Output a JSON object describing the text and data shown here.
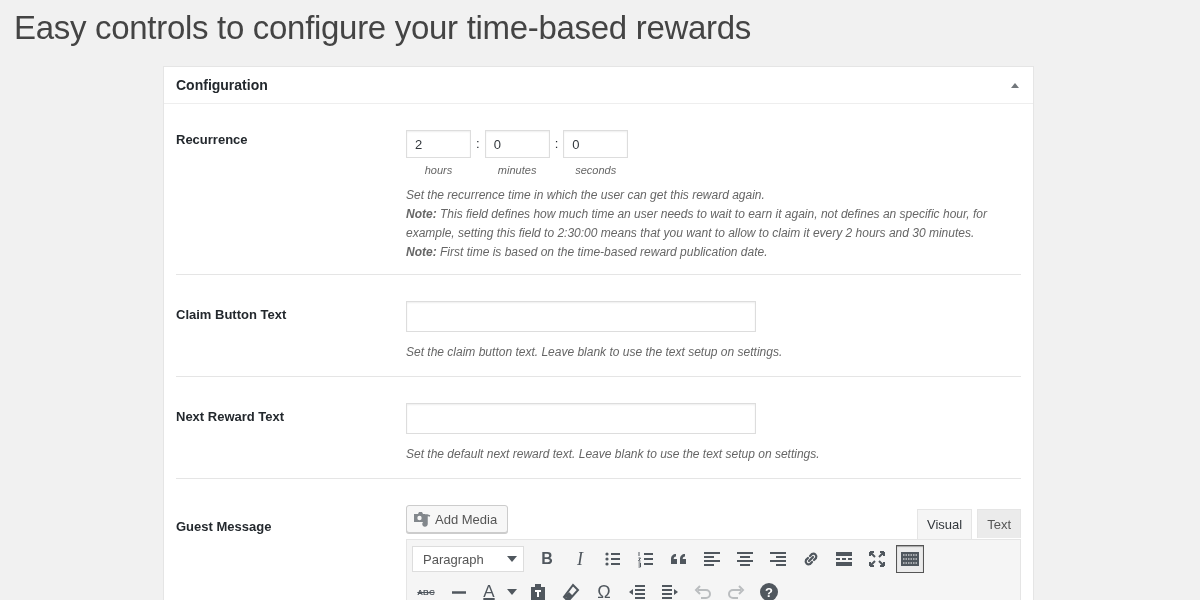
{
  "heading": "Easy controls to configure your time-based rewards",
  "panel": {
    "title": "Configuration",
    "expanded": true
  },
  "recurrence": {
    "label": "Recurrence",
    "fields": [
      {
        "value": "2",
        "unit": "hours"
      },
      {
        "separator": ":",
        "value": "0",
        "unit": "minutes"
      },
      {
        "separator": ":",
        "value": "0",
        "unit": "seconds"
      }
    ],
    "description": [
      "Set the recurrence time in which the user can get this reward again.",
      "**Note:** This field defines how much time an user needs to wait to earn it again, not defines an specific hour, for example, setting this field to 2:30:00 means that you want to allow to claim it every 2 hours and 30 minutes.",
      "**Note:** First time is based on the time-based reward publication date."
    ]
  },
  "text_fields": [
    {
      "label": "Claim Button Text",
      "description": "Set the claim button text. Leave blank to use the text setup on settings."
    },
    {
      "label": "Next Reward Text",
      "description": "Set the default next reward text. Leave blank to use the text setup on settings."
    }
  ],
  "guest_message": {
    "label": "Guest Message",
    "add_media": "Add Media",
    "tabs": [
      {
        "label": "Visual",
        "selected": true
      },
      {
        "label": "Text",
        "selected": false
      }
    ],
    "format_select": "Paragraph",
    "toolbar_rows": [
      [
        {
          "kind": "bold",
          "glyph": "B"
        },
        {
          "kind": "italic",
          "glyph": "I"
        },
        {
          "kind": "bullets"
        },
        {
          "kind": "numbers"
        },
        {
          "kind": "quote"
        },
        {
          "kind": "alignleft"
        },
        {
          "kind": "aligncenter"
        },
        {
          "kind": "alignright"
        },
        {
          "kind": "link"
        },
        {
          "kind": "more"
        },
        {
          "kind": "fullscreen"
        },
        {
          "kind": "toolbar",
          "pressed": true
        }
      ],
      [
        {
          "kind": "strike",
          "glyph": "ABC"
        },
        {
          "kind": "hr"
        },
        {
          "kind": "color",
          "glyph": "A"
        },
        {
          "kind": "caret"
        },
        {
          "kind": "paste"
        },
        {
          "kind": "eraser"
        },
        {
          "kind": "symbol",
          "glyph": "Ω"
        },
        {
          "kind": "outdent"
        },
        {
          "kind": "indent"
        },
        {
          "kind": "undo",
          "disabled": true
        },
        {
          "kind": "redo",
          "disabled": true
        },
        {
          "kind": "help",
          "glyph": "?"
        }
      ]
    ]
  }
}
